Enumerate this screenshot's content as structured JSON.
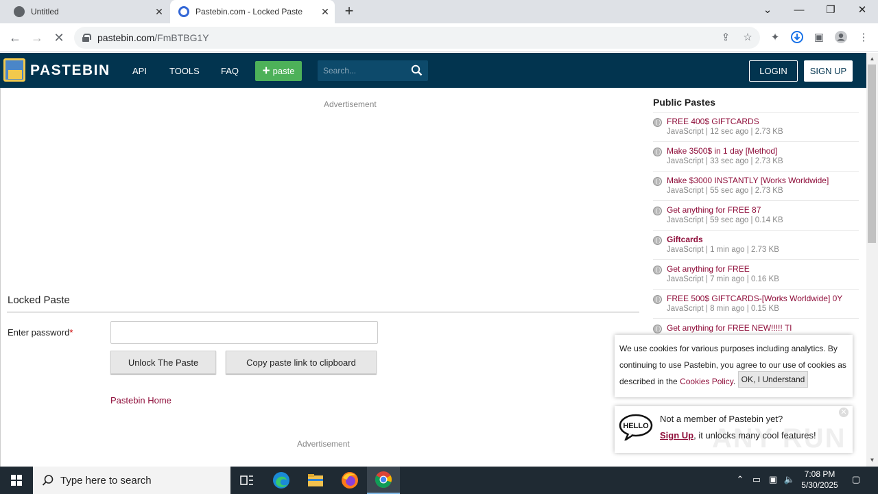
{
  "browser": {
    "tabs": [
      {
        "title": "Untitled"
      },
      {
        "title": "Pastebin.com - Locked Paste"
      }
    ],
    "url_host": "pastebin.com",
    "url_path": "/FmBTBG1Y"
  },
  "header": {
    "logo_text": "PASTEBIN",
    "nav": [
      "API",
      "TOOLS",
      "FAQ"
    ],
    "paste_button": "paste",
    "search_placeholder": "Search...",
    "login": "LOGIN",
    "signup": "SIGN UP"
  },
  "main": {
    "ad_label": "Advertisement",
    "locked_title": "Locked Paste",
    "password_label": "Enter password",
    "required_mark": "*",
    "unlock_button": "Unlock The Paste",
    "copy_button": "Copy paste link to clipboard",
    "home_link": "Pastebin Home"
  },
  "sidebar": {
    "title": "Public Pastes",
    "items": [
      {
        "title": "FREE 400$ GIFTCARDS",
        "meta": "JavaScript | 12 sec ago | 2.73 KB"
      },
      {
        "title": "Make 3500$ in 1 day [Method]",
        "meta": "JavaScript | 33 sec ago | 2.73 KB"
      },
      {
        "title": "Make $3000 INSTANTLY [Works Worldwide]",
        "meta": "JavaScript | 55 sec ago | 2.73 KB"
      },
      {
        "title": "Get anything for FREE 87",
        "meta": "JavaScript | 59 sec ago | 0.14 KB"
      },
      {
        "title": "Giftcards",
        "meta": "JavaScript | 1 min ago | 2.73 KB"
      },
      {
        "title": "Get anything for FREE",
        "meta": "JavaScript | 7 min ago | 0.16 KB"
      },
      {
        "title": "FREE 500$ GIFTCARDS-[Works Worldwide] 0Y",
        "meta": "JavaScript | 8 min ago | 0.15 KB"
      },
      {
        "title": "Get anything for FREE NEW!!!!! TI",
        "meta": ""
      }
    ]
  },
  "cookie": {
    "text_before": "We use cookies for various purposes including analytics. By continuing to use Pastebin, you agree to our use of cookies as described in the ",
    "link": "Cookies Policy",
    "text_after": ".",
    "ok": "OK, I Understand"
  },
  "member": {
    "question": "Not a member of Pastebin yet?",
    "signup": "Sign Up",
    "rest": ", it unlocks many cool features!"
  },
  "watermark": "ANY RUN",
  "taskbar": {
    "search_placeholder": "Type here to search",
    "time": "7:08 PM",
    "date": "5/30/2025"
  },
  "colors": {
    "header_bg": "#02344f",
    "paste_green": "#4db159",
    "link_red": "#8f0e3a"
  }
}
